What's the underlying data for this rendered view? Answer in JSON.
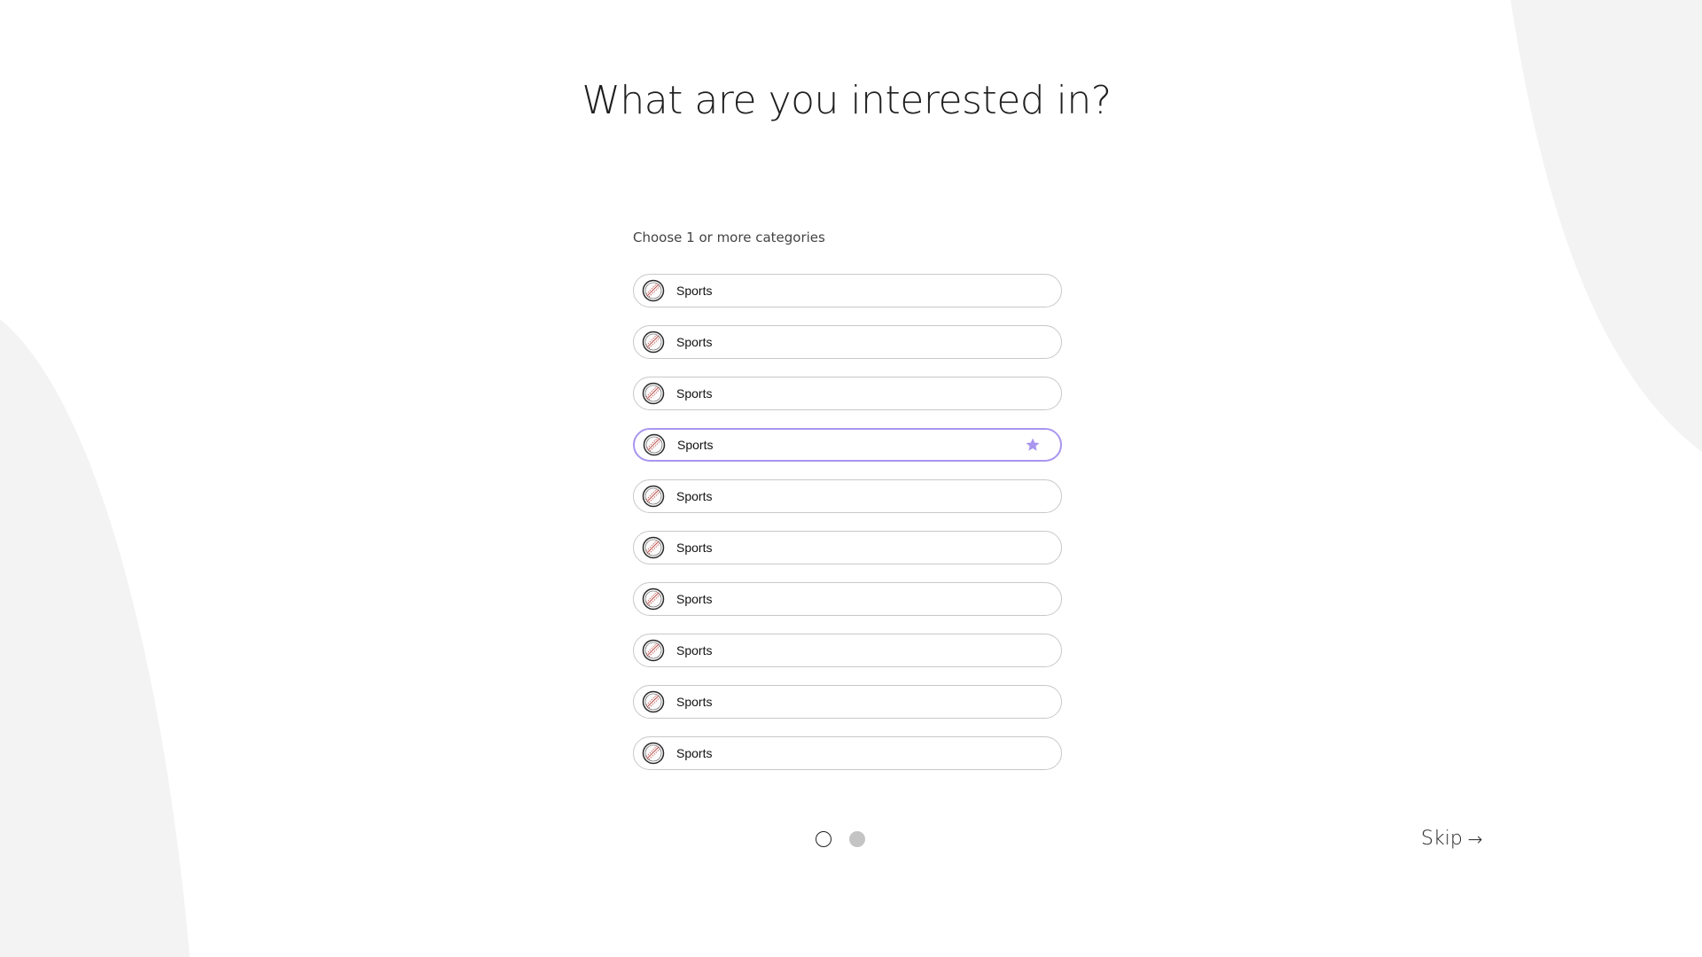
{
  "colors": {
    "background": "#ffffff",
    "decoration": "#f3f3f3",
    "accent": "#a996ef",
    "border": "#c8c8c8",
    "dot_inactive": "#c4c4c4"
  },
  "page": {
    "title": "What are you interested in?",
    "subtitle": "Choose 1 or more categories"
  },
  "categories": [
    {
      "label": "Sports",
      "icon": "baseball-icon",
      "selected": false
    },
    {
      "label": "Sports",
      "icon": "baseball-icon",
      "selected": false
    },
    {
      "label": "Sports",
      "icon": "baseball-icon",
      "selected": false
    },
    {
      "label": "Sports",
      "icon": "baseball-icon",
      "selected": true
    },
    {
      "label": "Sports",
      "icon": "baseball-icon",
      "selected": false
    },
    {
      "label": "Sports",
      "icon": "baseball-icon",
      "selected": false
    },
    {
      "label": "Sports",
      "icon": "baseball-icon",
      "selected": false
    },
    {
      "label": "Sports",
      "icon": "baseball-icon",
      "selected": false
    },
    {
      "label": "Sports",
      "icon": "baseball-icon",
      "selected": false
    },
    {
      "label": "Sports",
      "icon": "baseball-icon",
      "selected": false
    }
  ],
  "pagination": {
    "current_page": 1,
    "total_pages": 2
  },
  "skip": {
    "label": "Skip",
    "arrow": "→"
  }
}
